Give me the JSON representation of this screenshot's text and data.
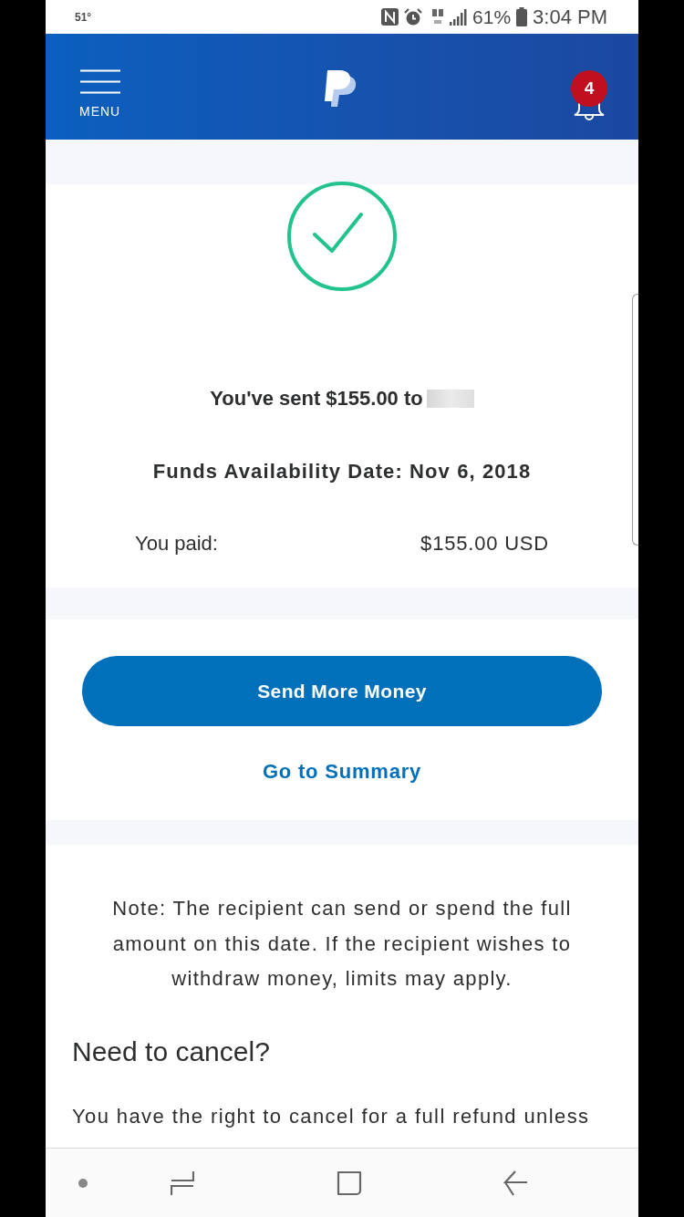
{
  "status_bar": {
    "temperature": "51°",
    "battery": "61%",
    "time": "3:04 PM"
  },
  "header": {
    "menu_label": "MENU",
    "notification_count": "4"
  },
  "confirmation": {
    "sent_text": "You've sent $155.00 to",
    "recipient_redacted": true,
    "funds_date": "Funds Availability Date: Nov 6, 2018",
    "rows": [
      {
        "label": "You paid:",
        "value": "$155.00 USD"
      }
    ]
  },
  "actions": {
    "primary_button": "Send More Money",
    "link": "Go to Summary"
  },
  "note": "Note: The recipient can send or spend the full amount on this date. If the recipient wishes to withdraw money, limits may apply.",
  "cancel_section": {
    "heading": "Need to cancel?",
    "text": "You have the right to cancel for a full refund unless"
  }
}
